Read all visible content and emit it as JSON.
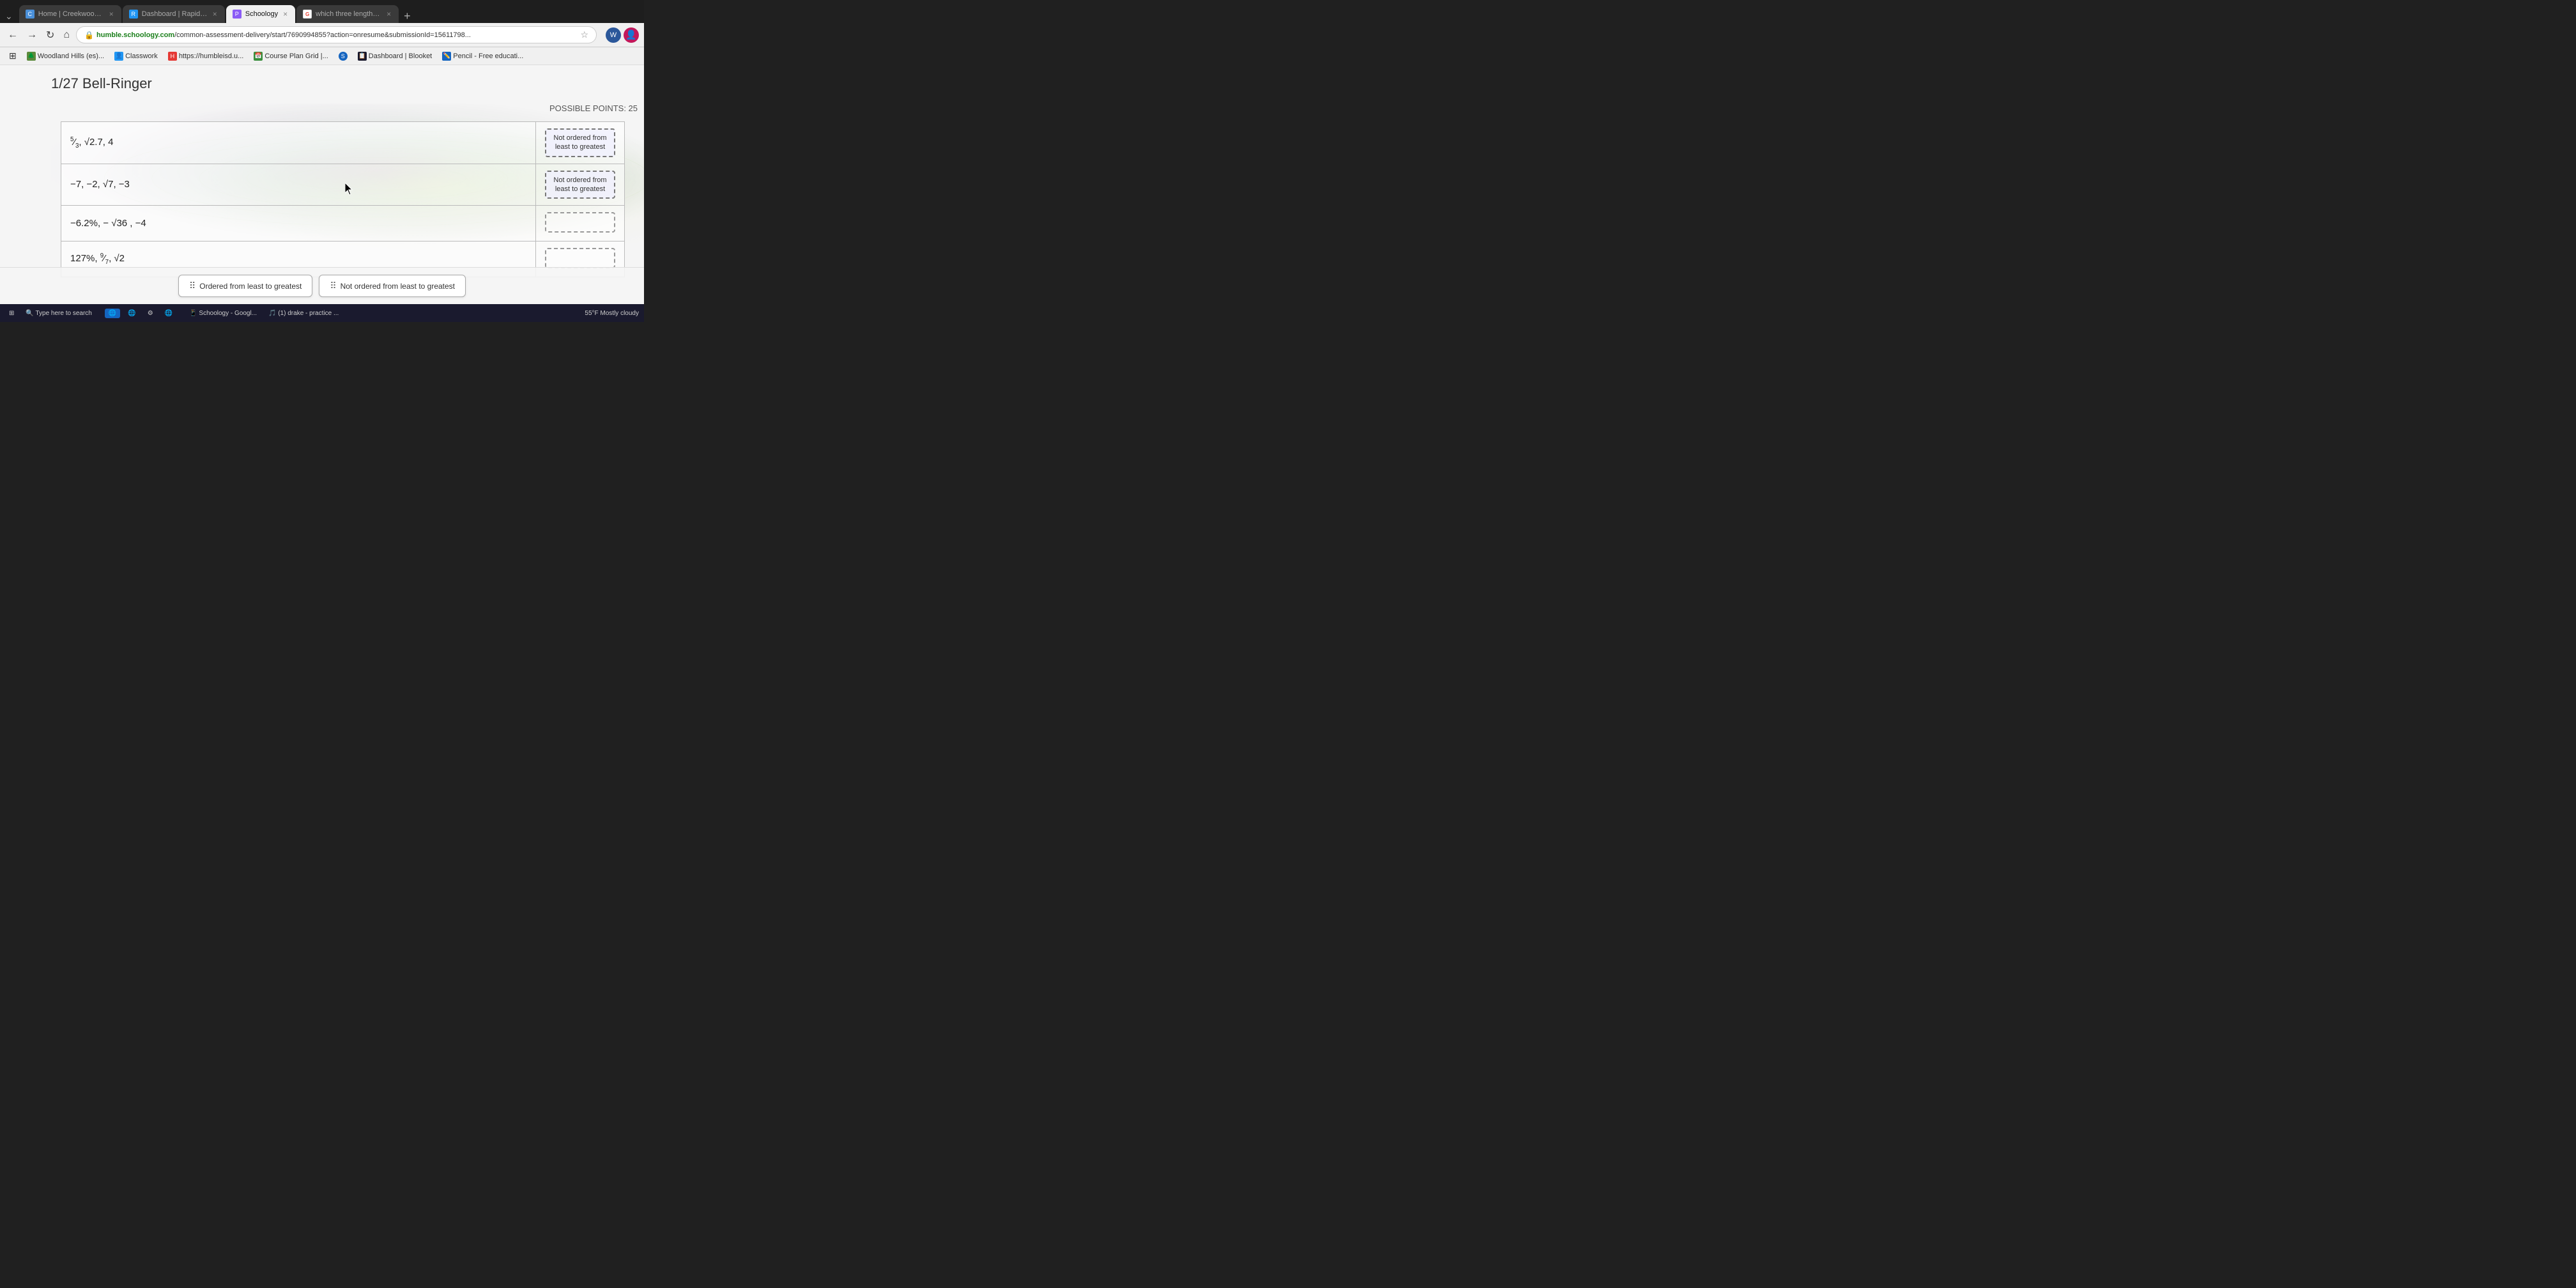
{
  "browser": {
    "tabs": [
      {
        "id": "home",
        "label": "Home | Creekwood Middle Sch",
        "favicon_color": "#4a90d9",
        "favicon_text": "C",
        "active": false
      },
      {
        "id": "rapid",
        "label": "Dashboard | RapidIdentity",
        "favicon_color": "#2196F3",
        "favicon_text": "R",
        "active": false
      },
      {
        "id": "schoology",
        "label": "Schoology",
        "favicon_color": "#8B5CF6",
        "favicon_text": "P",
        "active": true
      },
      {
        "id": "google",
        "label": "which three lengths could be u",
        "favicon_color": "#ea4335",
        "favicon_text": "G",
        "active": false
      }
    ],
    "address": "humble.schoology.com/common-assessment-delivery/start/7690994855?action=onresume&submissionId=15611798...",
    "address_prefix": "humble.schoology.com",
    "bookmarks": [
      {
        "label": "Woodland Hills (es)...",
        "icon": "🌲"
      },
      {
        "label": "Classwork",
        "icon": "👤"
      },
      {
        "label": "https://humbleisd.u...",
        "icon": "🔴"
      },
      {
        "label": "Course Plan Grid |...",
        "icon": "🌿"
      },
      {
        "label": "",
        "icon": "🔵"
      },
      {
        "label": "Dashboard | Blooket",
        "icon": "📋"
      },
      {
        "label": "Pencil - Free educati...",
        "icon": "✏️"
      }
    ]
  },
  "page": {
    "title": "1/27 Bell-Ringer",
    "possible_points": "POSSIBLE POINTS: 25",
    "rows": [
      {
        "expression": "5/3, √2.7, 4",
        "expression_display": "⁵⁄₃, √2.7, 4",
        "answer": "Not ordered from least to greatest",
        "answer_filled": true
      },
      {
        "expression": "−7, −2, √7, −3",
        "expression_display": "−7,  −2, √7,  −3",
        "answer": "Not ordered from least to greatest",
        "answer_filled": true
      },
      {
        "expression": "−6.2%, −√36, −4",
        "expression_display": "−6.2%,  − √36 ,  −4",
        "answer": "",
        "answer_filled": false
      },
      {
        "expression": "127%, 9/7, √2",
        "expression_display": "127%, ⁹⁄₇, √2",
        "answer": "",
        "answer_filled": false
      }
    ],
    "bottom_chips": [
      {
        "label": "Ordered from least to greatest",
        "id": "ordered"
      },
      {
        "label": "Not ordered from least to greatest",
        "id": "not-ordered"
      }
    ]
  },
  "taskbar": {
    "search_placeholder": "Type here to search",
    "weather": "55°F  Mostly cloudy",
    "time": "",
    "apps": [
      {
        "label": "Schoology - Googl..."
      },
      {
        "label": "(1) drake - practice ..."
      }
    ]
  }
}
